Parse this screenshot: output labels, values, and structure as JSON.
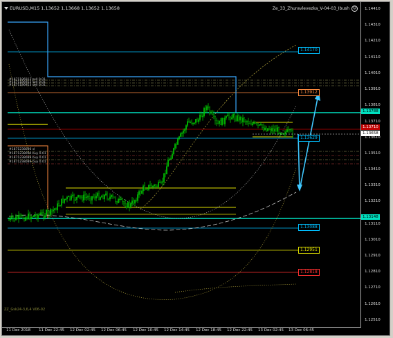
{
  "window": {
    "symbol_title": "EURUSD,M15  1.13652 1.13668 1.13652 1.13658",
    "indicator_title": "Ze_33_Zhuravlevezka_V-04-03_Ibush"
  },
  "price_axis": {
    "ticks": [
      "1.14410",
      "1.14310",
      "1.14210",
      "1.14110",
      "1.14010",
      "1.13910",
      "1.13810",
      "1.13710",
      "1.13610",
      "1.13510",
      "1.13410",
      "1.13310",
      "1.13210",
      "1.13110",
      "1.13010",
      "1.12910",
      "1.12810",
      "1.12710",
      "1.12610",
      "1.12510"
    ],
    "highlight_upper": {
      "text": "1.13788",
      "color": "#00e0c0"
    },
    "highlight_current_a": {
      "text": "1.13710",
      "color": "#c00000"
    },
    "highlight_current_b": {
      "text": "1.13658",
      "color": "#ffffff"
    },
    "highlight_lower": {
      "text": "1.13148",
      "color": "#00e0c0"
    }
  },
  "time_axis": {
    "labels": [
      "11 Dec 2018",
      "11 Dec 22:45",
      "12 Dec 02:45",
      "12 Dec 06:45",
      "12 Dec 10:45",
      "12 Dec 14:45",
      "12 Dec 18:45",
      "12 Dec 22:45",
      "13 Dec 02:45",
      "13 Dec 06:45"
    ]
  },
  "levels": [
    {
      "text": "1.14170",
      "color": "#00bfff"
    },
    {
      "text": "1.13912",
      "color": "#ff8c40"
    },
    {
      "text": "1.13629",
      "color": "#00bfff"
    },
    {
      "text": "1.13088",
      "color": "#00bfff"
    },
    {
      "text": "1.12951",
      "color": "#e0e000"
    },
    {
      "text": "1.12818",
      "color": "#ff3030"
    }
  ],
  "object_labels": {
    "top_cluster": "#1871186913 sell 0.01",
    "left_cluster_a": "#1871238096 sl",
    "left_cluster_b": "#1871238090 buy 0.01",
    "left_cluster_c": "#1871238089 buy 0.01"
  },
  "footer": "ZZ_Gsk24-3,6,4 V06-02",
  "colors": {
    "background": "#000000",
    "candles": "#00c800",
    "cyan": "#00e0c0",
    "blue": "#00bfff",
    "yellow": "#e0e000",
    "orange": "#ff8c40",
    "red": "#ff3030"
  }
}
